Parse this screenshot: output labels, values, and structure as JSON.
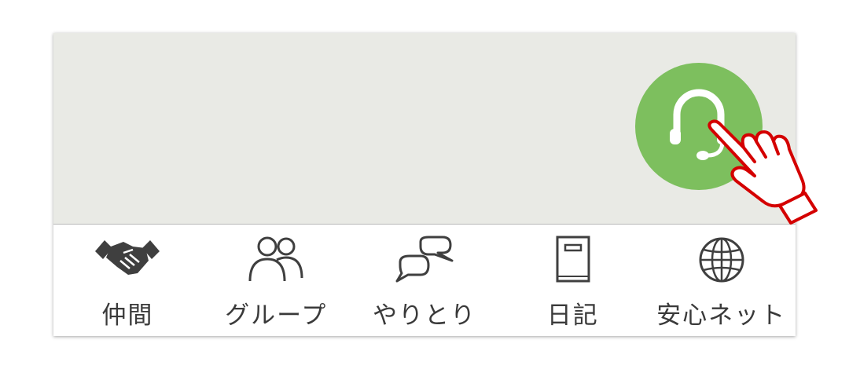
{
  "colors": {
    "content_bg": "#e9eae5",
    "fab": "#7dbf5e",
    "fab_icon": "#ffffff",
    "tab_icon": "#3f3f3f",
    "tab_label": "#3a3a3a",
    "hand_stroke": "#d40000"
  },
  "fab": {
    "icon": "headset-icon"
  },
  "tabs": [
    {
      "label": "仲間",
      "icon": "handshake-icon"
    },
    {
      "label": "グループ",
      "icon": "group-people-icon"
    },
    {
      "label": "やりとり",
      "icon": "chat-bubbles-icon"
    },
    {
      "label": "日記",
      "icon": "diary-notebook-icon"
    },
    {
      "label": "安心ネット",
      "icon": "globe-icon"
    }
  ],
  "overlay": {
    "icon": "pointing-hand-icon"
  }
}
